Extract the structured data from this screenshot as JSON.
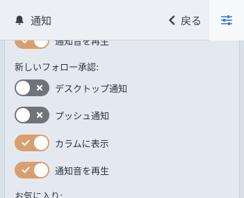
{
  "header": {
    "title": "通知",
    "back_label": "戻る",
    "icons": {
      "title": "bell-icon",
      "back": "chevron-left-icon",
      "settings": "sliders-icon"
    }
  },
  "content": {
    "partial_row": {
      "label": "通知音を再生",
      "state": "on"
    },
    "follow_requests": {
      "title": "新しいフォロー承認:",
      "items": [
        {
          "label": "デスクトップ通知",
          "state": "off"
        },
        {
          "label": "プッシュ通知",
          "state": "off"
        },
        {
          "label": "カラムに表示",
          "state": "on"
        },
        {
          "label": "通知音を再生",
          "state": "on"
        }
      ]
    },
    "favourites": {
      "title": "お気に入り:"
    }
  },
  "colors": {
    "toggle_on": "#d8a070",
    "toggle_off": "#6f7479",
    "header_bg": "#eceff3",
    "content_bg": "#e4e9ef"
  }
}
